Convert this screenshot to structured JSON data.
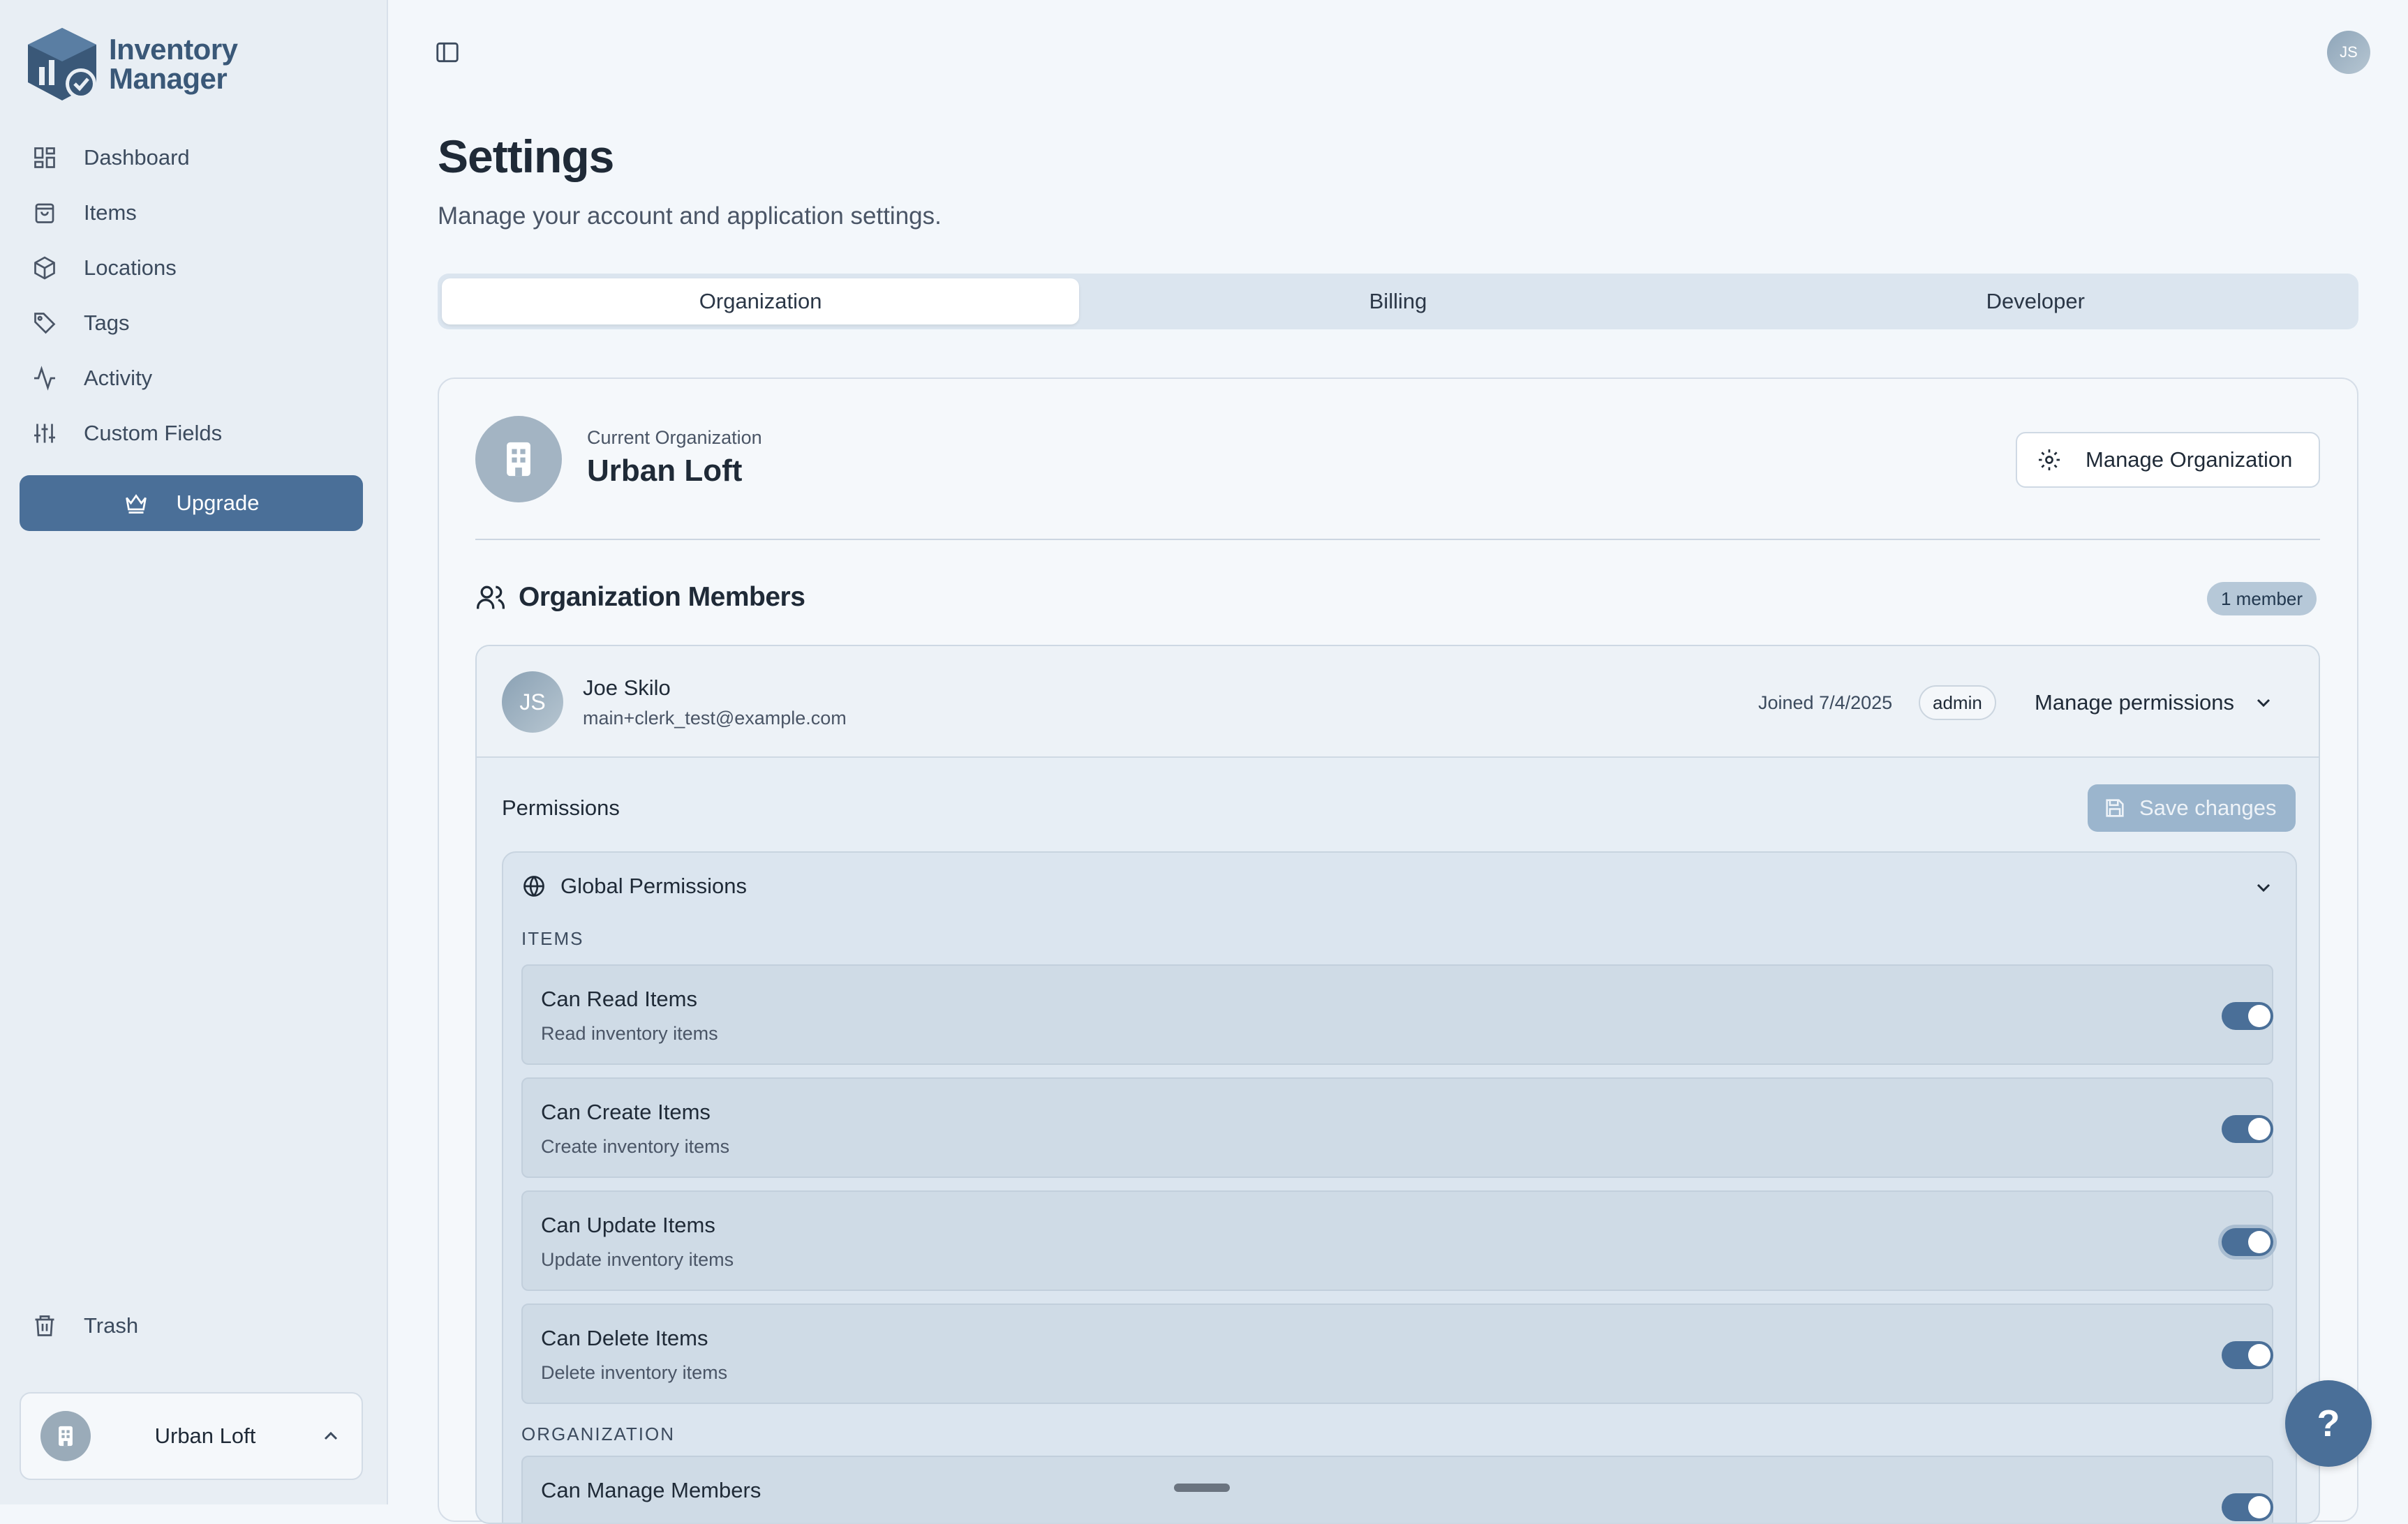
{
  "app": {
    "logo_line1": "Inventory",
    "logo_line2": "Manager"
  },
  "sidebar": {
    "items": [
      {
        "label": "Dashboard",
        "icon": "dashboard-icon"
      },
      {
        "label": "Items",
        "icon": "bag-icon"
      },
      {
        "label": "Locations",
        "icon": "box-icon"
      },
      {
        "label": "Tags",
        "icon": "tag-icon"
      },
      {
        "label": "Activity",
        "icon": "activity-icon"
      },
      {
        "label": "Custom Fields",
        "icon": "sliders-icon"
      }
    ],
    "upgrade_label": "Upgrade",
    "trash_label": "Trash",
    "org_switcher_name": "Urban Loft"
  },
  "user": {
    "initials": "JS"
  },
  "page": {
    "title": "Settings",
    "subtitle": "Manage your account and application settings."
  },
  "tabs": [
    {
      "label": "Organization",
      "active": true
    },
    {
      "label": "Billing",
      "active": false
    },
    {
      "label": "Developer",
      "active": false
    }
  ],
  "organization": {
    "current_label": "Current Organization",
    "name": "Urban Loft",
    "manage_button": "Manage Organization",
    "members_title": "Organization Members",
    "member_count": "1 member"
  },
  "member": {
    "initials": "JS",
    "name": "Joe Skilo",
    "email": "main+clerk_test@example.com",
    "joined": "Joined 7/4/2025",
    "role": "admin",
    "manage_permissions": "Manage permissions"
  },
  "permissions": {
    "label": "Permissions",
    "save_button": "Save changes",
    "global_title": "Global Permissions",
    "sections": [
      {
        "label": "ITEMS",
        "rows": [
          {
            "title": "Can Read Items",
            "desc": "Read inventory items",
            "enabled": true
          },
          {
            "title": "Can Create Items",
            "desc": "Create inventory items",
            "enabled": true
          },
          {
            "title": "Can Update Items",
            "desc": "Update inventory items",
            "enabled": true
          },
          {
            "title": "Can Delete Items",
            "desc": "Delete inventory items",
            "enabled": true
          }
        ]
      },
      {
        "label": "ORGANIZATION",
        "rows": [
          {
            "title": "Can Manage Members",
            "desc": "",
            "enabled": true
          }
        ]
      }
    ]
  },
  "help_label": "?",
  "colors": {
    "accent": "#4a6f98",
    "background": "#f3f7fb",
    "sidebar": "#e8eef4"
  }
}
